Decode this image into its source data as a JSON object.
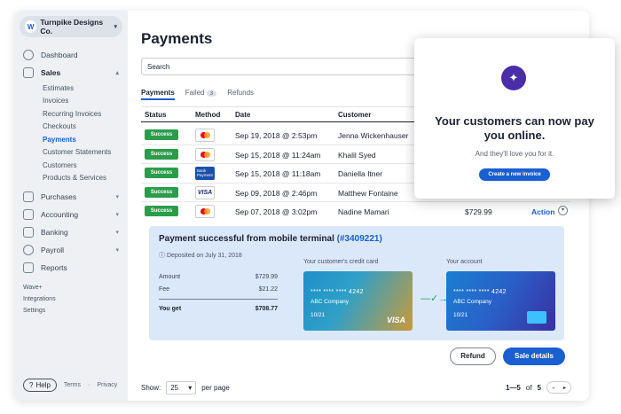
{
  "sidebar": {
    "company": "Turnpike Designs Co.",
    "logo_letter": "W",
    "nav": [
      "Dashboard",
      "Sales"
    ],
    "sales_sub": [
      "Estimates",
      "Invoices",
      "Recurring Invoices",
      "Checkouts",
      "Payments",
      "Customer Statements",
      "Customers",
      "Products & Services"
    ],
    "nav2": [
      "Purchases",
      "Accounting",
      "Banking",
      "Payroll",
      "Reports"
    ],
    "links": [
      "Wave+",
      "Integrations",
      "Settings"
    ],
    "help": "Help",
    "terms": "Terms",
    "privacy": "Privacy"
  },
  "main": {
    "title": "Payments",
    "search_placeholder": "Search",
    "tabs": [
      {
        "label": "Payments"
      },
      {
        "label": "Failed",
        "badge": "3"
      },
      {
        "label": "Refunds"
      }
    ],
    "columns": [
      "Status",
      "Method",
      "Date",
      "Customer"
    ],
    "rows": [
      {
        "status": "Success",
        "method": "mastercard",
        "date": "Sep 19, 2018 @ 2:53pm",
        "customer": "Jenna Wickenhauser"
      },
      {
        "status": "Success",
        "method": "mastercard",
        "date": "Sep 15, 2018 @ 11:24am",
        "customer": "Khalil Syed"
      },
      {
        "status": "Success",
        "method": "bank",
        "method_label": "Bank Payment",
        "date": "Sep 15, 2018 @ 11:18am",
        "customer": "Daniella Itner"
      },
      {
        "status": "Success",
        "method": "visa",
        "method_label": "VISA",
        "date": "Sep 09, 2018 @ 2:46pm",
        "customer": "Matthew Fontaine"
      },
      {
        "status": "Success",
        "method": "mastercard",
        "date": "Sep 07, 2018 @ 3:02pm",
        "customer": "Nadine Mamari",
        "amount": "$729.99",
        "action": "Action"
      }
    ],
    "detail": {
      "title": "Payment successful from mobile terminal",
      "ref": "(#3409221)",
      "deposited": "Deposited on July 31, 2018",
      "amount_label": "Amount",
      "amount": "$729.99",
      "fee_label": "Fee",
      "fee": "$21.22",
      "you_get_label": "You get",
      "you_get": "$708.77",
      "card1_label": "Your customer's credit card",
      "card2_label": "Your account",
      "card_number": "**** **** **** 4242",
      "card_company": "ABC Company",
      "card_exp": "10/21",
      "visa": "VISA"
    },
    "refund": "Refund",
    "sale_details": "Sale details",
    "show_label": "Show:",
    "per_page_value": "25",
    "per_page": "per page",
    "range": "1—5",
    "of": "of",
    "total": "5"
  },
  "popup": {
    "title": "Your customers can now pay you online.",
    "subtitle": "And they'll love you for it.",
    "button": "Create a new invoice"
  }
}
